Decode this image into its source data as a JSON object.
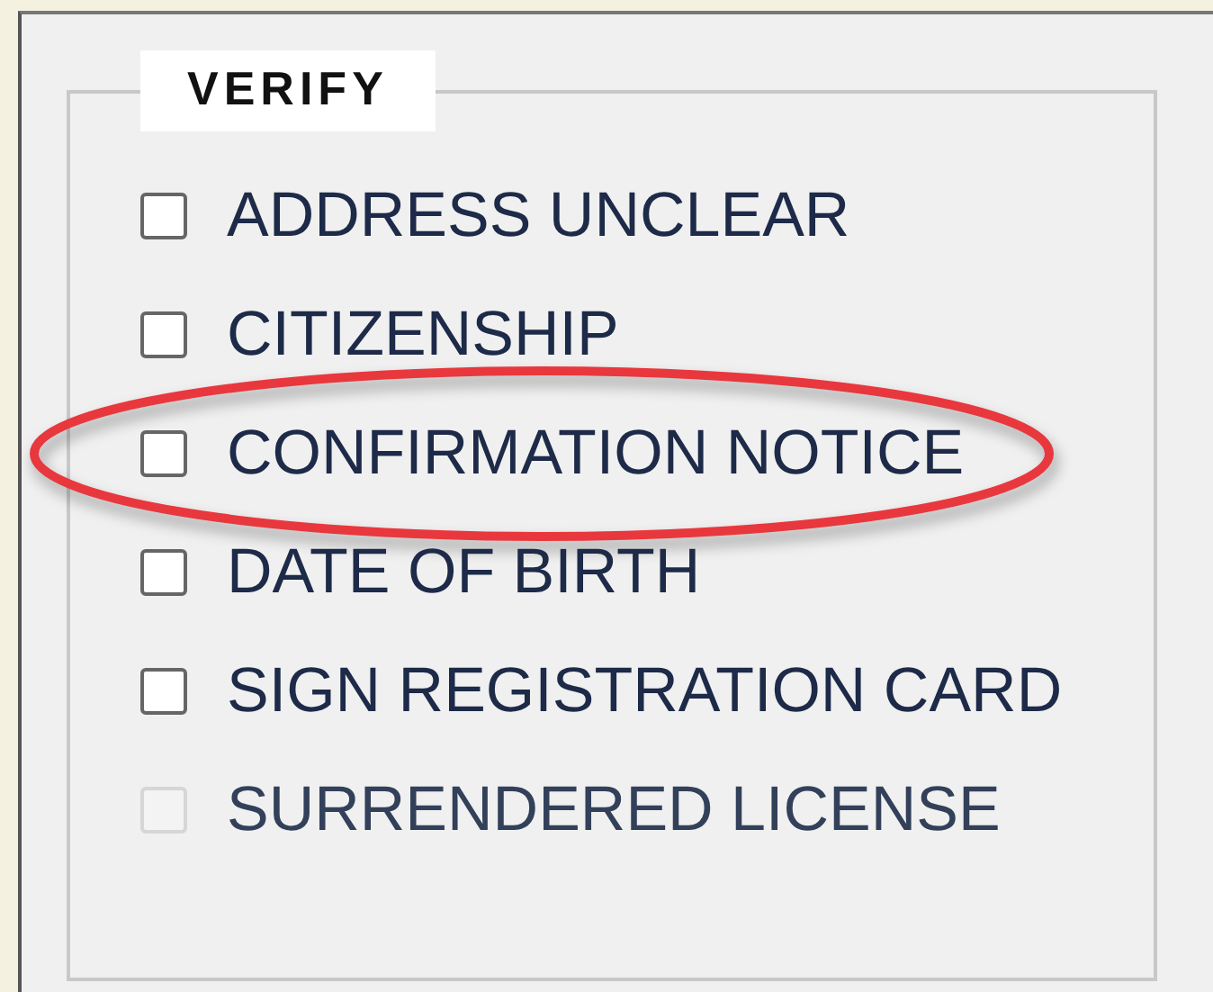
{
  "group": {
    "title": "VERIFY"
  },
  "items": [
    {
      "label": "ADDRESS UNCLEAR",
      "checked": false,
      "disabled": false,
      "highlighted": false
    },
    {
      "label": "CITIZENSHIP",
      "checked": false,
      "disabled": false,
      "highlighted": false
    },
    {
      "label": "CONFIRMATION NOTICE",
      "checked": false,
      "disabled": false,
      "highlighted": true
    },
    {
      "label": "DATE OF BIRTH",
      "checked": false,
      "disabled": false,
      "highlighted": false
    },
    {
      "label": "SIGN REGISTRATION CARD",
      "checked": false,
      "disabled": false,
      "highlighted": false
    },
    {
      "label": "SURRENDERED LICENSE",
      "checked": false,
      "disabled": true,
      "highlighted": false
    }
  ]
}
